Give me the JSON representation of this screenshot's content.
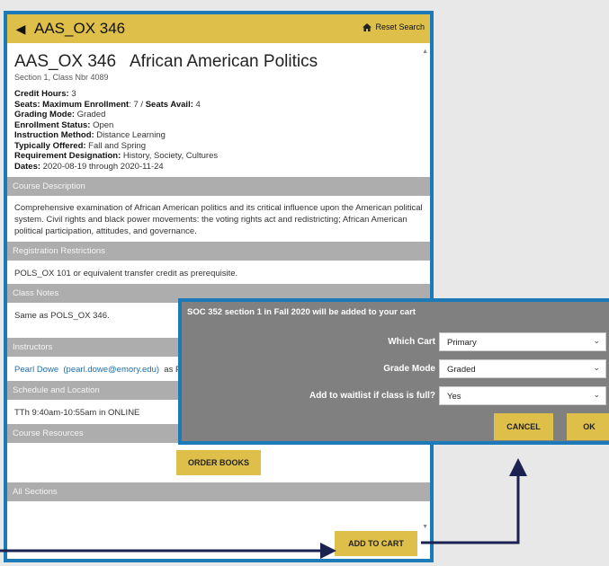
{
  "header": {
    "back_glyph": "◀",
    "title": "AAS_OX 346",
    "reset_label": "Reset Search",
    "reset_icon": "home-icon"
  },
  "course": {
    "code": "AAS_OX 346",
    "title": "African American Politics",
    "section_line": "Section 1, Class Nbr 4089",
    "details": [
      {
        "label": "Credit Hours:",
        "value": " 3"
      },
      {
        "label": "Seats: Maximum Enrollment",
        "value": ": 7 / ",
        "label2": "Seats Avail:",
        "value2": " 4"
      },
      {
        "label": "Grading Mode:",
        "value": " Graded"
      },
      {
        "label": "Enrollment Status:",
        "value": " Open"
      },
      {
        "label": "Instruction Method:",
        "value": " Distance Learning"
      },
      {
        "label": "Typically Offered:",
        "value": " Fall and Spring"
      },
      {
        "label": "Requirement Designation:",
        "value": " History, Society, Cultures"
      },
      {
        "label": "Dates:",
        "value": " 2020-08-19 through 2020-11-24"
      }
    ]
  },
  "sections": {
    "description_title": "Course Description",
    "description_text": "Comprehensive examination of African American politics and its critical influence upon the American political system. Civil rights and black power movements: the voting rights act and redistricting; African American political participation, attitudes, and governance.",
    "restrictions_title": "Registration Restrictions",
    "restrictions_text": "POLS_OX 101 or equivalent transfer credit as prerequisite.",
    "notes_title": "Class Notes",
    "notes_text": "Same as POLS_OX 346.",
    "instructors_title": "Instructors",
    "instructor_name": "Pearl Dowe",
    "instructor_email": "(pearl.dowe@emory.edu)",
    "instructor_role": "as P",
    "schedule_title": "Schedule and Location",
    "schedule_text": "TTh 9:40am-10:55am in ONLINE",
    "resources_title": "Course Resources",
    "order_books_label": "ORDER BOOKS",
    "all_sections_title": "All Sections"
  },
  "footer": {
    "add_to_cart_label": "ADD TO CART"
  },
  "dialog": {
    "title": "SOC 352 section 1 in Fall 2020 will be added to your cart",
    "which_cart_label": "Which Cart",
    "which_cart_value": "Primary",
    "grade_mode_label": "Grade Mode",
    "grade_mode_value": "Graded",
    "waitlist_label": "Add to waitlist if class is full?",
    "waitlist_value": "Yes",
    "cancel_label": "CANCEL",
    "ok_label": "OK"
  },
  "colors": {
    "accent": "#ddbf4a",
    "frame": "#1d7ab8",
    "section_bar": "#adadad",
    "dialog_bg": "#808080",
    "arrow": "#1b2150"
  }
}
